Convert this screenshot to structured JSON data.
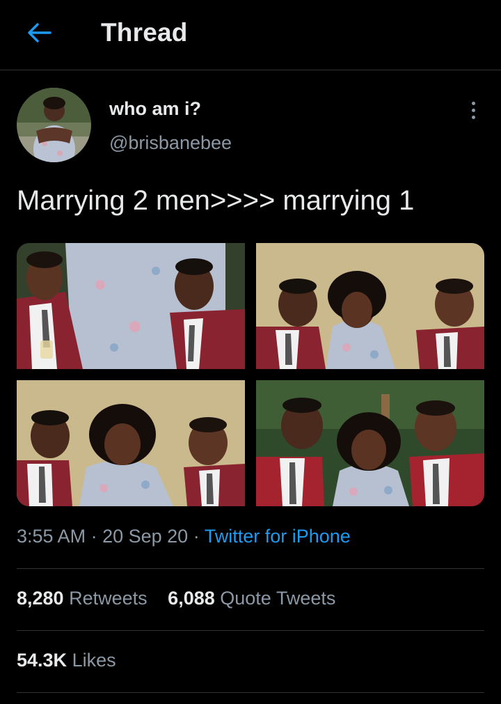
{
  "header": {
    "title": "Thread",
    "back_icon": "arrow-left-icon"
  },
  "colors": {
    "background": "#000000",
    "text": "#e7e9ea",
    "secondary": "#8b98a5",
    "accent": "#1d9bf0",
    "divider": "#2f3336"
  },
  "tweet": {
    "author": {
      "display_name": "who am i?",
      "handle": "@brisbanebee"
    },
    "text": "Marrying 2 men>>>> marrying 1",
    "media_count": 4,
    "time": "3:55 AM",
    "date": "20 Sep 20",
    "separator": "·",
    "source": "Twitter for iPhone"
  },
  "stats": {
    "retweets": {
      "value": "8,280",
      "label": "Retweets"
    },
    "quotes": {
      "value": "6,088",
      "label": "Quote Tweets"
    },
    "likes": {
      "value": "54.3K",
      "label": "Likes"
    }
  }
}
